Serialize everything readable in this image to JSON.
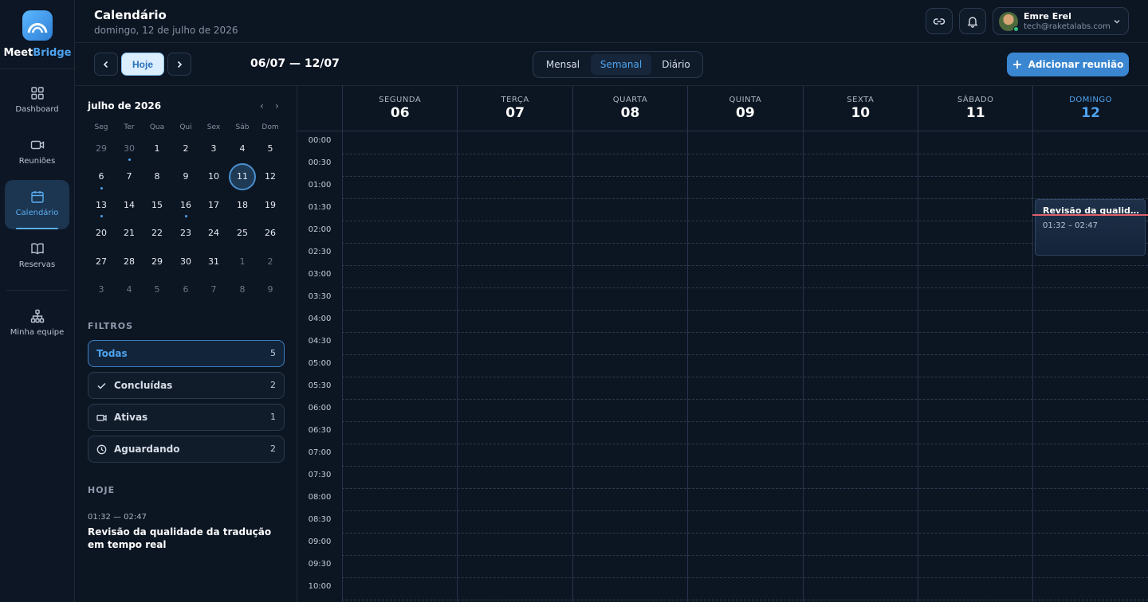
{
  "brand": {
    "part1": "Meet",
    "part2": "Bridge"
  },
  "nav": [
    {
      "label": "Dashboard",
      "icon": "grid-icon"
    },
    {
      "label": "Reuniões",
      "icon": "video-icon"
    },
    {
      "label": "Calendário",
      "icon": "calendar-icon",
      "active": true
    },
    {
      "label": "Reservas",
      "icon": "book-icon"
    },
    {
      "label": "Minha equipe",
      "icon": "team-icon"
    }
  ],
  "header": {
    "title": "Calendário",
    "subtitle": "domingo, 12 de julho de 2026"
  },
  "user": {
    "name": "Emre Erel",
    "email": "tech@raketalabs.com",
    "status_color": "#2ec27e"
  },
  "toolbar": {
    "today_label": "Hoje",
    "range": "06/07 — 12/07",
    "views": [
      "Mensal",
      "Semanal",
      "Diário"
    ],
    "selected_view": "Semanal",
    "add_label": "Adicionar reunião"
  },
  "mini_calendar": {
    "title": "julho de 2026",
    "prev": "‹",
    "next": "›",
    "weekdays": [
      "Seg",
      "Ter",
      "Qua",
      "Qui",
      "Sex",
      "Sáb",
      "Dom"
    ],
    "weeks": [
      [
        "29",
        "30",
        "1",
        "2",
        "3",
        "4",
        "5"
      ],
      [
        "6",
        "7",
        "8",
        "9",
        "10",
        "11",
        "12"
      ],
      [
        "13",
        "14",
        "15",
        "16",
        "17",
        "18",
        "19"
      ],
      [
        "20",
        "21",
        "22",
        "23",
        "24",
        "25",
        "26"
      ],
      [
        "27",
        "28",
        "29",
        "30",
        "31",
        "1",
        "2"
      ],
      [
        "3",
        "4",
        "5",
        "6",
        "7",
        "8",
        "9"
      ]
    ],
    "selected": "11"
  },
  "filters": {
    "title": "FILTROS",
    "items": [
      {
        "label": "Todas",
        "count": "5"
      },
      {
        "label": "Concluídas",
        "count": "2",
        "icon": "check-icon"
      },
      {
        "label": "Ativas",
        "count": "1",
        "icon": "video-icon"
      },
      {
        "label": "Aguardando",
        "count": "2",
        "icon": "clock-icon"
      }
    ]
  },
  "today_section": {
    "title": "HOJE",
    "time": "01:32 — 02:47",
    "event_title": "Revisão da qualidade da tradução em tempo real"
  },
  "week": {
    "days": [
      {
        "name": "SEGUNDA",
        "num": "06"
      },
      {
        "name": "TERÇA",
        "num": "07"
      },
      {
        "name": "QUARTA",
        "num": "08"
      },
      {
        "name": "QUINTA",
        "num": "09"
      },
      {
        "name": "SEXTA",
        "num": "10"
      },
      {
        "name": "SÁBADO",
        "num": "11"
      },
      {
        "name": "DOMINGO",
        "num": "12",
        "today": true
      }
    ],
    "times": [
      "00:00",
      "00:30",
      "01:00",
      "01:30",
      "02:00",
      "02:30",
      "03:00",
      "03:30",
      "04:00",
      "04:30",
      "05:00",
      "05:30",
      "06:00",
      "06:30",
      "07:00",
      "07:30",
      "08:00",
      "08:30",
      "09:00",
      "09:30",
      "10:00"
    ]
  },
  "event": {
    "title": "Revisão da qualidade da tradução em tempo real",
    "time": "01:32 – 02:47"
  },
  "colors": {
    "accent": "#4ea3ef",
    "now_line": "#e0626b",
    "background": "#0c1522"
  }
}
